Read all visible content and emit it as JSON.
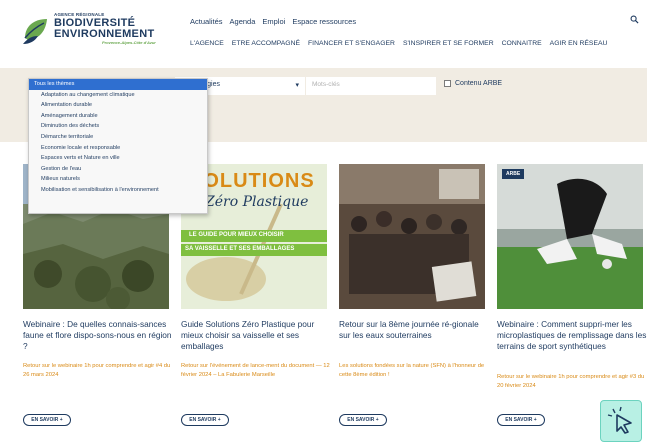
{
  "brand": {
    "small": "AGENCE RÉGIONALE",
    "line1": "BIODIVERSITÉ",
    "line2": "ENVIRONNEMENT",
    "sub": "Provence-Alpes-Côte d'Azur",
    "colors": {
      "navy": "#1e3a5f",
      "green": "#6aa84f",
      "orange": "#d98a16"
    }
  },
  "topnav": [
    "Actualités",
    "Agenda",
    "Emploi",
    "Espace ressources"
  ],
  "mainnav": [
    "L'AGENCE",
    "ETRE ACCOMPAGNÉ",
    "FINANCER ET S'ENGAGER",
    "S'INSPIRER ET SE FORMER",
    "CONNAITRE",
    "AGIR EN RÉSEAU"
  ],
  "filters": {
    "theme_options": [
      "Tous les thèmes",
      "Adaptation au changement climatique",
      "Alimentation durable",
      "Aménagement durable",
      "Diminution des déchets",
      "Démarche territoriale",
      "Economie locale et responsable",
      "Espaces verts et Nature en ville",
      "Gestion de l'eau",
      "Milieux naturels",
      "Mobilisation et sensibilisation à l'environnement"
    ],
    "typology_value": "s typologies",
    "search_placeholder": "Mots-clés",
    "checkbox_label": "Contenu ARBE"
  },
  "cards": [
    {
      "title": "Webinaire : De quelles connais-sances faune et flore dispo-sons-nous en région ?",
      "meta": "Retour sur le webinaire 1h pour comprendre et agir #4 du 26 mars 2024",
      "button": "EN SAVOIR +"
    },
    {
      "title": "Guide Solutions Zéro Plastique pour mieux choisir sa vaisselle et ses emballages",
      "meta": "Retour sur l'événement de lance-ment du document — 12 février 2024 – La Fabulerie Marseille",
      "button": "EN SAVOIR +",
      "image_text": {
        "headline": "SOLUTIONS",
        "script": "Zéro Plastique",
        "banner1": "LE GUIDE POUR MIEUX CHOISIR",
        "banner2": "SA VAISSELLE ET SES EMBALLAGES"
      }
    },
    {
      "title": "Retour sur la 8ème journée ré-gionale sur les eaux souterraines",
      "meta": "Les solutions fondées sur la nature (SFN) à l'honneur de cette 8ème édition !",
      "button": "EN SAVOIR +"
    },
    {
      "title": "Webinaire : Comment suppri-mer les microplastiques de remplissage dans les terrains de sport synthétiques",
      "meta": "Retour sur le webinaire 1h pour comprendre et agir #3 du 20 février 2024",
      "button": "EN SAVOIR +",
      "badge": "ARBE"
    }
  ]
}
